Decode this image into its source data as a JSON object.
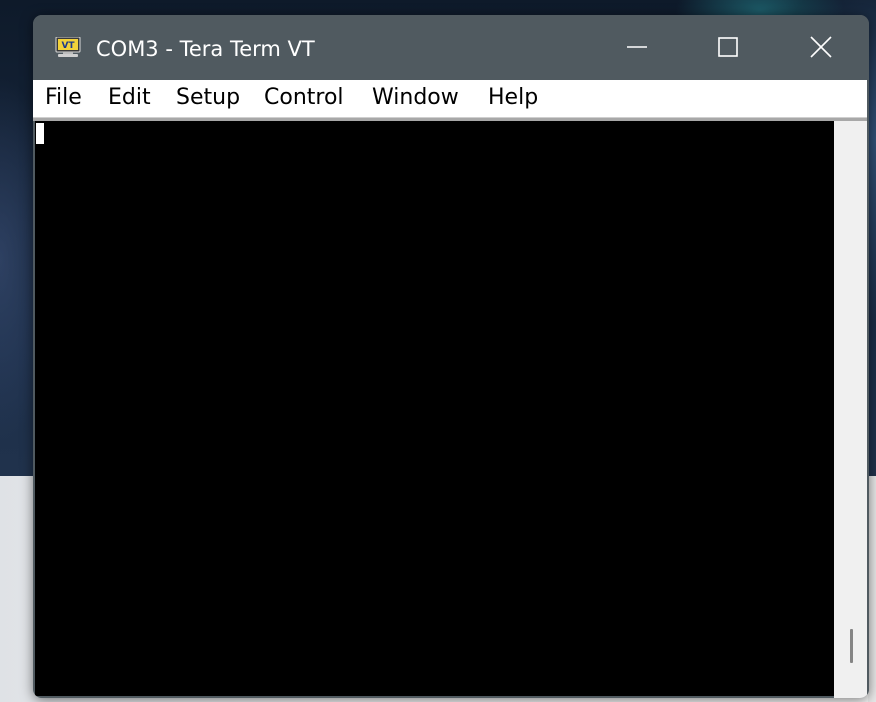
{
  "window": {
    "title": "COM3 - Tera Term VT",
    "app_icon": "tera-term-vt-icon",
    "app_icon_text": "VT",
    "controls": {
      "minimize": "minimize-icon",
      "maximize": "maximize-icon",
      "close": "close-icon"
    }
  },
  "menubar": {
    "items": [
      {
        "label": "File"
      },
      {
        "label": "Edit"
      },
      {
        "label": "Setup"
      },
      {
        "label": "Control"
      },
      {
        "label": "Window"
      },
      {
        "label": "Help"
      }
    ]
  },
  "terminal": {
    "background": "#000000",
    "cursor_color": "#ffffff",
    "content": ""
  },
  "colors": {
    "titlebar": "#505a60",
    "menubar": "#ffffff",
    "scrollbar_track": "#f0f0f0"
  }
}
